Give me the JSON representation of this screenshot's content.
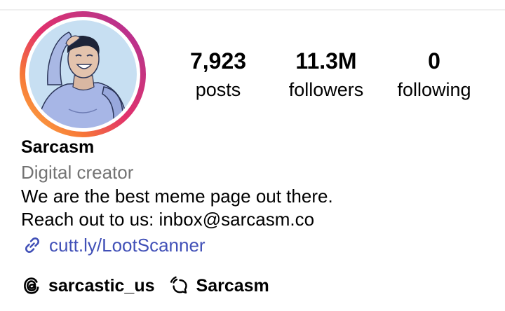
{
  "profile": {
    "avatar_icon": "profile-avatar-illustration",
    "story_ring_colors": [
      "#FCAF45",
      "#F77737",
      "#FD1D1D",
      "#E1306C",
      "#C13584",
      "#833AB4"
    ],
    "stats": {
      "posts": {
        "count": "7,923",
        "label": "posts"
      },
      "followers": {
        "count": "11.3M",
        "label": "followers"
      },
      "following": {
        "count": "0",
        "label": "following"
      }
    },
    "name": "Sarcasm",
    "category": "Digital creator",
    "bio": {
      "line1": "We are the best meme page out there.",
      "line2": "Reach out to us: inbox@sarcasm.co"
    },
    "link": {
      "icon": "link-icon",
      "text": "cutt.ly/LootScanner",
      "color": "#4150B7"
    },
    "threads": {
      "icon": "threads-icon",
      "handle": "sarcastic_us"
    },
    "channel": {
      "icon": "broadcast-channel-icon",
      "name": "Sarcasm"
    }
  }
}
